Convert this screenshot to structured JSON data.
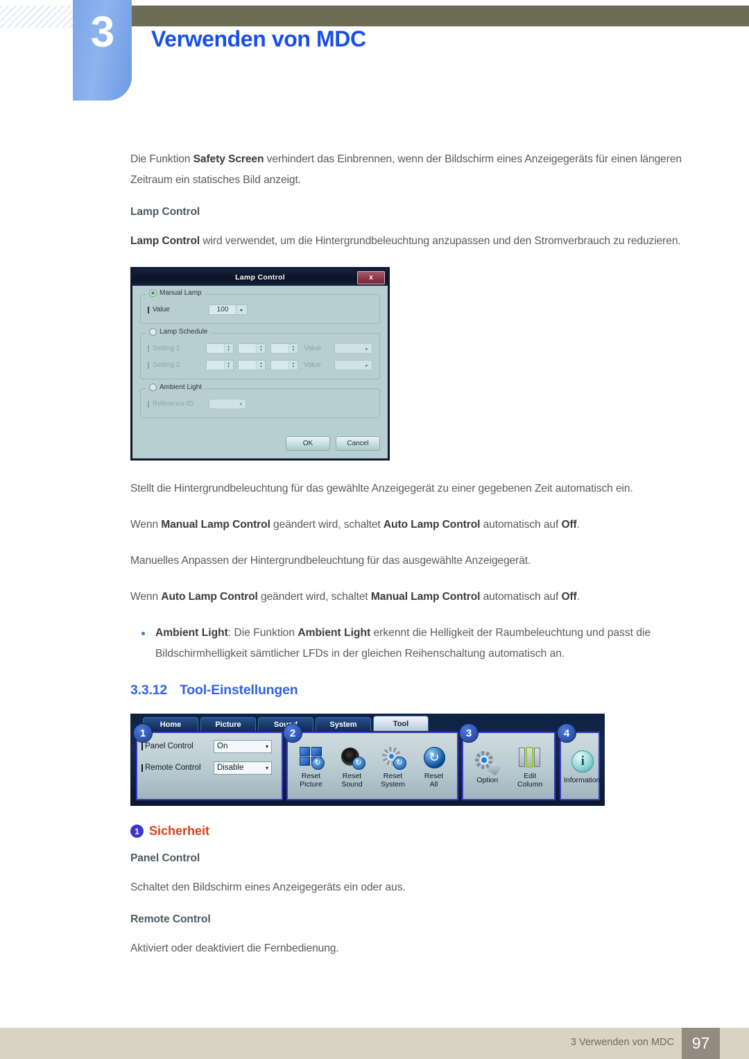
{
  "header": {
    "chapter_number": "3",
    "chapter_title": "Verwenden von MDC"
  },
  "content": {
    "intro_para": {
      "pre": "Die Funktion ",
      "bold1": "Safety Screen",
      "post": " verhindert das Einbrennen, wenn der Bildschirm eines Anzeigegeräts für einen längeren Zeitraum ein statisches Bild anzeigt."
    },
    "lamp_control_heading": "Lamp Control",
    "lamp_control_para": {
      "bold1": "Lamp Control",
      "post": " wird verwendet, um die Hintergrundbeleuchtung anzupassen und den Stromverbrauch zu reduzieren."
    },
    "after_dialog_para1": "Stellt die Hintergrundbeleuchtung für das gewählte Anzeigegerät zu einer gegebenen Zeit automatisch ein.",
    "after_dialog_para2": {
      "t1": "Wenn ",
      "b1": "Manual Lamp Control",
      "t2": " geändert wird, schaltet ",
      "b2": "Auto Lamp Control",
      "t3": " automatisch auf ",
      "b3": "Off",
      "t4": "."
    },
    "after_dialog_para3": "Manuelles Anpassen der Hintergrundbeleuchtung für das ausgewählte Anzeigegerät.",
    "after_dialog_para4": {
      "t1": "Wenn ",
      "b1": "Auto Lamp Control",
      "t2": " geändert wird, schaltet ",
      "b2": "Manual Lamp Control",
      "t3": " automatisch auf ",
      "b3": "Off",
      "t4": "."
    },
    "bullet_ambient": {
      "b1": "Ambient Light",
      "t1": ": Die Funktion ",
      "b2": "Ambient Light",
      "t2": " erkennt die Helligkeit der Raumbeleuchtung und passt die Bildschirmhelligkeit sämtlicher LFDs in der gleichen Reihenschaltung automatisch an."
    },
    "section": {
      "number": "3.3.12",
      "title": "Tool-Einstellungen"
    },
    "annotation": {
      "badge": "1",
      "title": "Sicherheit"
    },
    "panel_control_heading": "Panel Control",
    "panel_control_text": "Schaltet den Bildschirm eines Anzeigegeräts ein oder aus.",
    "remote_control_heading": "Remote Control",
    "remote_control_text": "Aktiviert oder deaktiviert die Fernbedienung."
  },
  "lamp_dialog": {
    "title": "Lamp Control",
    "close_label": "x",
    "manual_lamp_group": "Manual Lamp",
    "value_label": "Value",
    "value_amount": "100",
    "value_arrow": "▸",
    "lamp_schedule_group": "Lamp Schedule",
    "setting1_label": "Setting 1",
    "setting2_label": "Setting 2",
    "schedule_value_label": "Value",
    "colon": ":",
    "spin_up": "▴",
    "spin_down": "▾",
    "ambient_light_group": "Ambient Light",
    "reference_id_label": "Reference ID",
    "combo_caret": "▾",
    "ok_label": "OK",
    "cancel_label": "Cancel"
  },
  "tool_screenshot": {
    "tabs": [
      {
        "label": "Home",
        "active": false
      },
      {
        "label": "Picture",
        "active": false
      },
      {
        "label": "Sound",
        "active": false
      },
      {
        "label": "System",
        "active": false
      },
      {
        "label": "Tool",
        "active": true
      }
    ],
    "badges": [
      "1",
      "2",
      "3",
      "4"
    ],
    "panel1": {
      "rows": [
        {
          "label": "Panel Control",
          "value": "On"
        },
        {
          "label": "Remote Control",
          "value": "Disable"
        }
      ],
      "caret": "▾"
    },
    "panel2_icons": [
      {
        "name": "reset-picture-icon",
        "line1": "Reset",
        "line2": "Picture"
      },
      {
        "name": "reset-sound-icon",
        "line1": "Reset",
        "line2": "Sound"
      },
      {
        "name": "reset-system-icon",
        "line1": "Reset",
        "line2": "System"
      },
      {
        "name": "reset-all-icon",
        "line1": "Reset",
        "line2": "All"
      }
    ],
    "panel3_icons": [
      {
        "name": "option-icon",
        "line1": "Option",
        "line2": ""
      },
      {
        "name": "edit-column-icon",
        "line1": "Edit",
        "line2": "Column"
      }
    ],
    "panel4_icons": [
      {
        "name": "information-icon",
        "line1": "Information",
        "line2": ""
      }
    ],
    "refresh_glyph": "↻",
    "info_glyph": "i"
  },
  "footer": {
    "text": "3 Verwenden von MDC",
    "page_number": "97"
  },
  "colors": {
    "header_bar": "#6d6c55",
    "chapter_tab": "#7ba5e8",
    "chapter_title": "#1a4ee8",
    "section_head": "#2f63e0",
    "annotation_title": "#d9411e",
    "annotation_badge": "#3b36cf",
    "footer_bar": "#d9d3c3",
    "footer_page_box": "#948a7f",
    "body_text": "#59595b",
    "subhead": "#4b5a63"
  }
}
